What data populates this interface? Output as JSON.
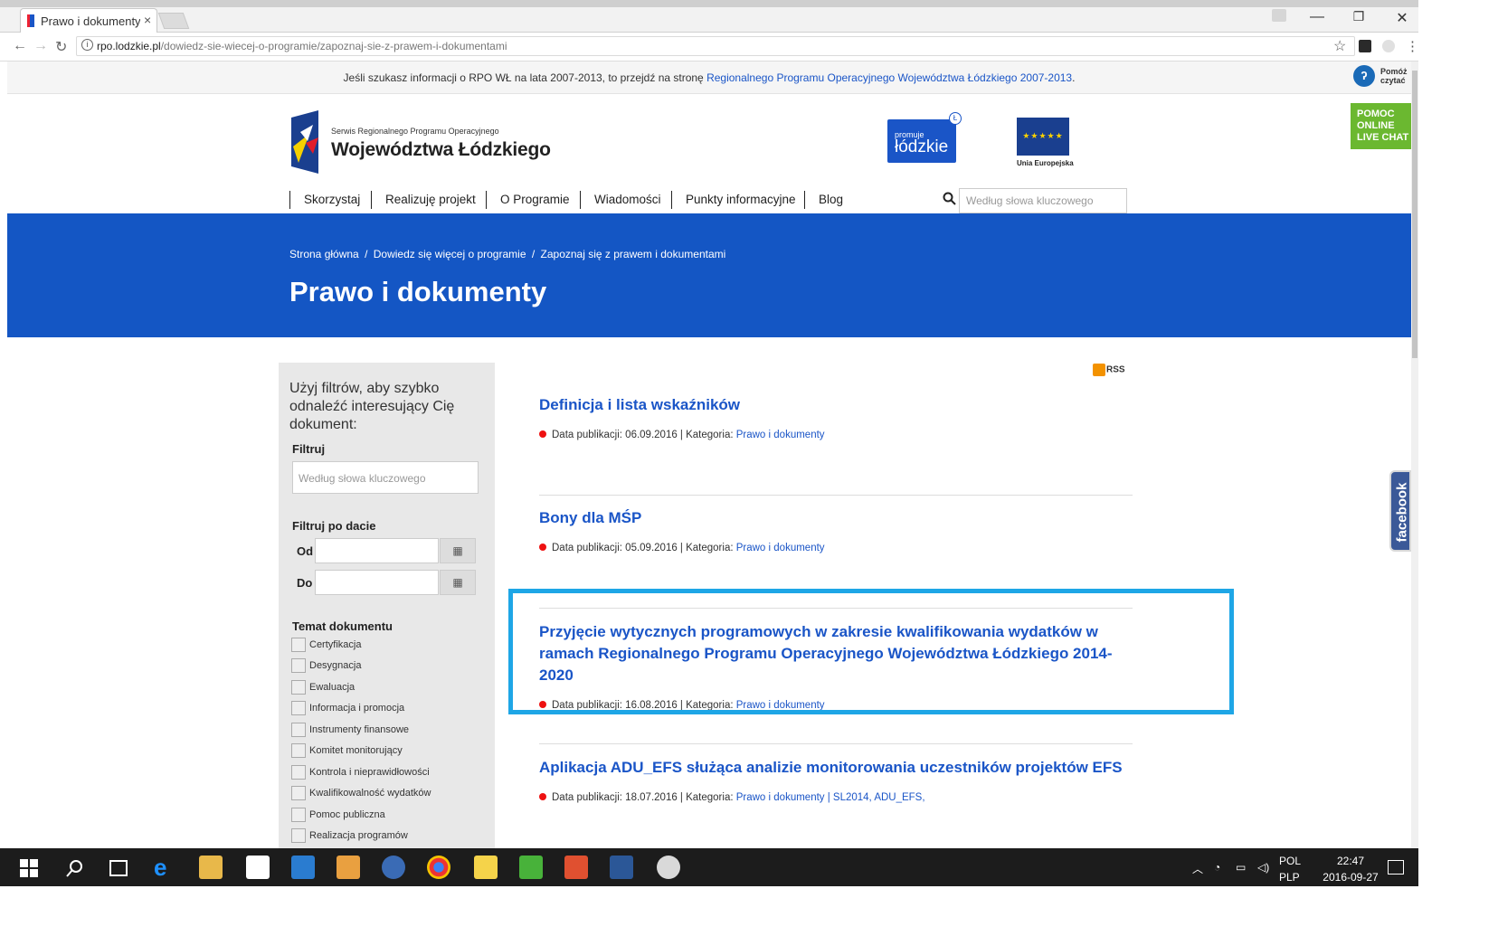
{
  "browser": {
    "tab_title": "Prawo i dokumenty",
    "tab_close": "×",
    "url_host": "rpo.lodzkie.pl",
    "url_path": "/dowiedz-sie-wiecej-o-programie/zapoznaj-sie-z-prawem-i-dokumentami",
    "controls": {
      "minimize": "—",
      "restore": "❐",
      "close": "✕"
    },
    "nav": {
      "back": "←",
      "forward": "→",
      "reload": "↻"
    },
    "bookmark": "☆",
    "menu": "⋮"
  },
  "notice": {
    "text": "Jeśli szukasz informacji o RPO WŁ na lata 2007-2013, to przejdź na stronę ",
    "link": "Regionalnego Programu Operacyjnego Województwa Łódzkiego 2007-2013",
    "tail": "."
  },
  "help_read": {
    "line1": "Pomóż",
    "line2": "czytać"
  },
  "header": {
    "logo_small": "Serwis Regionalnego Programu Operacyjnego",
    "logo_big": "Województwa Łódzkiego",
    "promuje_small": "promuje",
    "promuje_big": "łódzkie",
    "promuje_badge": "Ł",
    "eu_label": "Unia Europejska",
    "eu_stars": "★★★★★",
    "livechat": [
      "POMOC",
      "ONLINE",
      "LIVE CHAT"
    ]
  },
  "menu": [
    "Skorzystaj",
    "Realizuję projekt",
    "O Programie",
    "Wiadomości",
    "Punkty informacyjne",
    "Blog"
  ],
  "search": {
    "placeholder": "Według słowa kluczowego"
  },
  "breadcrumb": [
    "Strona główna",
    "/",
    "Dowiedz się więcej o programie",
    "/",
    "Zapoznaj się z prawem i dokumentami"
  ],
  "page_title": "Prawo i dokumenty",
  "sidebar": {
    "intro": "Użyj filtrów, aby szybko odnaleźć interesujący Cię dokument:",
    "filter_heading": "Filtruj",
    "filter_placeholder": "Według słowa kluczowego",
    "date_heading": "Filtruj po dacie",
    "from_label": "Od",
    "to_label": "Do",
    "calendar_glyph": "▦",
    "topic_heading": "Temat dokumentu",
    "topics": [
      "Certyfikacja",
      "Desygnacja",
      "Ewaluacja",
      "Informacja i promocja",
      "Instrumenty finansowe",
      "Komitet monitorujący",
      "Kontrola i nieprawidłowości",
      "Kwalifikowalność wydatków",
      "Pomoc publiczna",
      "Realizacja programów"
    ]
  },
  "rss_label": "RSS",
  "articles": [
    {
      "title": "Definicja i lista wskaźników",
      "meta": "Data publikacji: 06.09.2016 | Kategoria: ",
      "category": "Prawo i dokumenty",
      "extra": ""
    },
    {
      "title": "Bony dla MŚP",
      "meta": "Data publikacji: 05.09.2016 | Kategoria: ",
      "category": "Prawo i dokumenty",
      "extra": ""
    },
    {
      "title": "Przyjęcie wytycznych programowych w zakresie kwalifikowania wydatków w ramach Regionalnego Programu Operacyjnego Województwa Łódzkiego 2014-2020",
      "meta": "Data publikacji: 16.08.2016 | Kategoria: ",
      "category": "Prawo i dokumenty",
      "extra": ""
    },
    {
      "title": "Aplikacja ADU_EFS służąca analizie monitorowania uczestników projektów EFS",
      "meta": "Data publikacji: 18.07.2016 | Kategoria: ",
      "category": "Prawo i dokumenty",
      "extra": " | SL2014, ADU_EFS,"
    }
  ],
  "facebook_label": "facebook",
  "taskbar": {
    "lang1": "POL",
    "lang2": "PLP",
    "time": "22:47",
    "date": "2016-09-27",
    "icons": [
      "windows-start-icon",
      "search-icon",
      "task-view-icon",
      "edge-icon",
      "file-explorer-icon",
      "store-icon",
      "app-icon",
      "media-icon",
      "thunderbird-icon",
      "chrome-icon",
      "sticky-notes-icon",
      "app-green-icon",
      "office-icon",
      "word-icon",
      "paint-icon"
    ]
  },
  "colors": {
    "accent": "#1456c4",
    "link": "#1a55c7",
    "highlight": "#1ea6e6",
    "livechat": "#6bb830"
  }
}
